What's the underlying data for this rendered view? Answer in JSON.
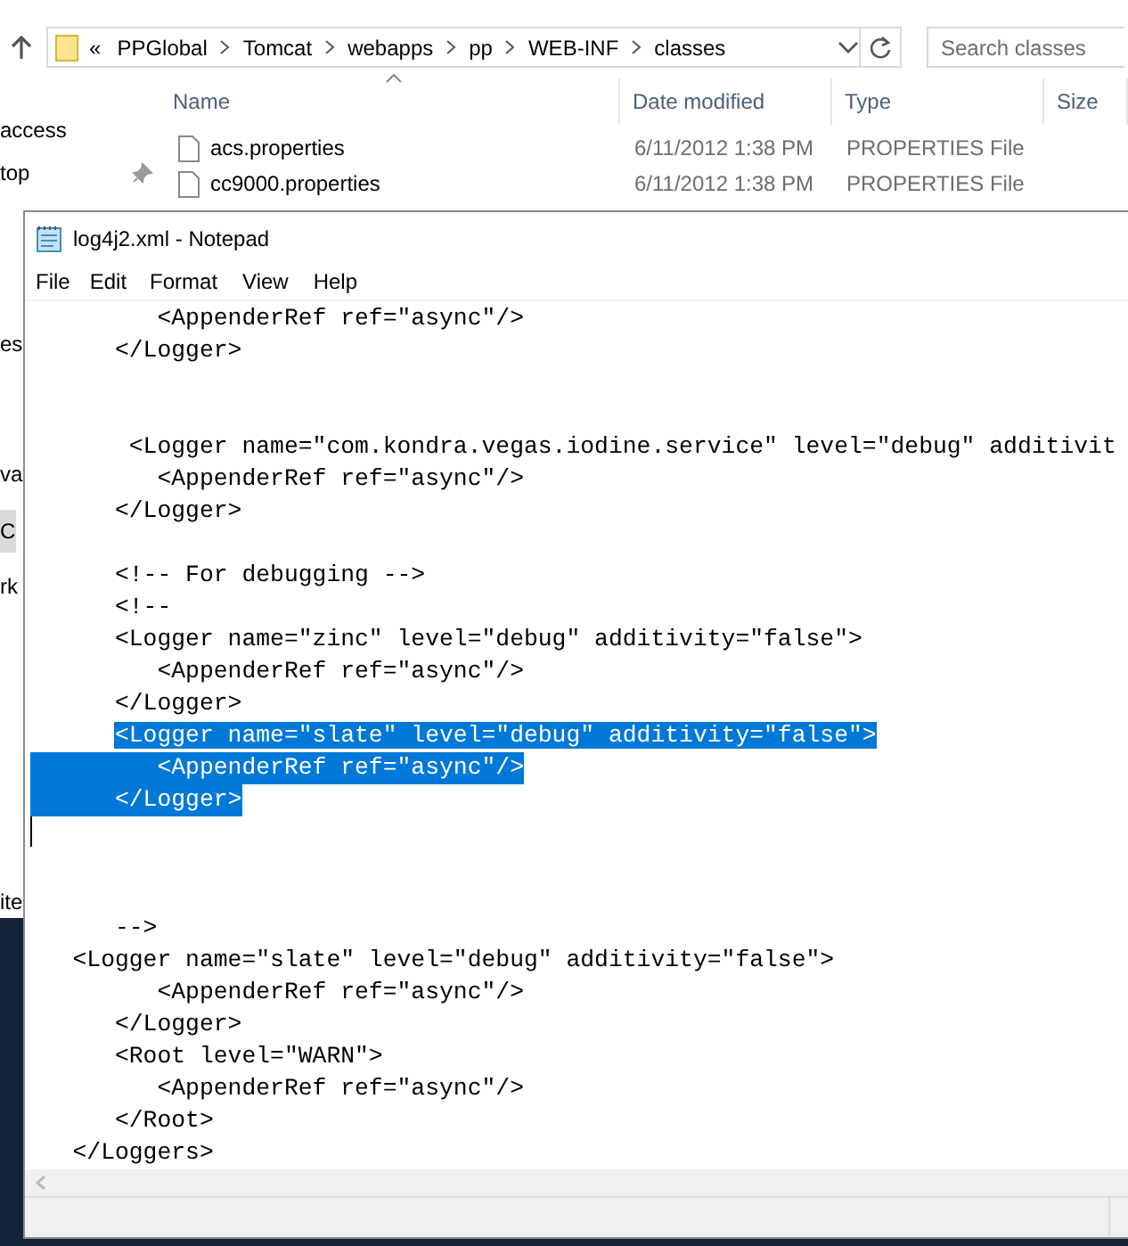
{
  "explorer": {
    "address": {
      "overflow": "«",
      "crumbs": [
        "PPGlobal",
        "Tomcat",
        "webapps",
        "pp",
        "WEB-INF",
        "classes"
      ]
    },
    "search": {
      "placeholder": "Search classes"
    },
    "nav": [
      {
        "label": "access",
        "pinned": false,
        "selected": false
      },
      {
        "label": "top",
        "pinned": true,
        "selected": false
      },
      {
        "label": "es",
        "pinned": false,
        "selected": false
      },
      {
        "label": "va",
        "pinned": false,
        "selected": false
      },
      {
        "label": "C",
        "pinned": false,
        "selected": true
      },
      {
        "label": "rk",
        "pinned": false,
        "selected": false
      },
      {
        "label": "ite",
        "pinned": false,
        "selected": false
      }
    ],
    "columns": [
      "Name",
      "Date modified",
      "Type",
      "Size"
    ],
    "files": [
      {
        "name": "acs.properties",
        "date": "6/11/2012 1:38 PM",
        "type": "PROPERTIES File"
      },
      {
        "name": "cc9000.properties",
        "date": "6/11/2012 1:38 PM",
        "type": "PROPERTIES File"
      }
    ]
  },
  "notepad": {
    "title": "log4j2.xml - Notepad",
    "menu": [
      "File",
      "Edit",
      "Format",
      "View",
      "Help"
    ],
    "lines": [
      {
        "text": "         <AppenderRef ref=\"async\"/>",
        "selected": false,
        "caret": false
      },
      {
        "text": "      </Logger>",
        "selected": false,
        "caret": false
      },
      {
        "selected": false,
        "caret": false
      },
      {
        "selected": false,
        "caret": false
      },
      {
        "text": "       <Logger name=\"com.kondra.vegas.iodine.service\" level=\"debug\" additivit",
        "selected": false,
        "caret": false
      },
      {
        "text": "         <AppenderRef ref=\"async\"/>",
        "selected": false,
        "caret": false
      },
      {
        "text": "      </Logger>",
        "selected": false,
        "caret": false
      },
      {
        "selected": false,
        "caret": false
      },
      {
        "text": "      <!-- For debugging -->",
        "selected": false,
        "caret": false
      },
      {
        "text": "      <!--",
        "selected": false,
        "caret": false
      },
      {
        "text": "      <Logger name=\"zinc\" level=\"debug\" additivity=\"false\">",
        "selected": false,
        "caret": false
      },
      {
        "text": "         <AppenderRef ref=\"async\"/>",
        "selected": false,
        "caret": false
      },
      {
        "text": "      </Logger>",
        "selected": false,
        "caret": false
      },
      {
        "text": "      <Logger name=\"slate\" level=\"debug\" additivity=\"false\">",
        "selected": true,
        "caret": false
      },
      {
        "text": "         <AppenderRef ref=\"async\"/>",
        "selected": true,
        "caret": false
      },
      {
        "text": "      </Logger>",
        "selected": true,
        "caret": false
      },
      {
        "selected": false,
        "caret": true
      },
      {
        "selected": false,
        "caret": false
      },
      {
        "selected": false,
        "caret": false
      },
      {
        "text": "      -->",
        "selected": false,
        "caret": false
      },
      {
        "text": "   <Logger name=\"slate\" level=\"debug\" additivity=\"false\">",
        "selected": false,
        "caret": false
      },
      {
        "text": "         <AppenderRef ref=\"async\"/>",
        "selected": false,
        "caret": false
      },
      {
        "text": "      </Logger>",
        "selected": false,
        "caret": false
      },
      {
        "text": "      <Root level=\"WARN\">",
        "selected": false,
        "caret": false
      },
      {
        "text": "         <AppenderRef ref=\"async\"/>",
        "selected": false,
        "caret": false
      },
      {
        "text": "      </Root>",
        "selected": false,
        "caret": false
      },
      {
        "text": "   </Loggers>",
        "selected": false,
        "caret": false
      }
    ]
  }
}
